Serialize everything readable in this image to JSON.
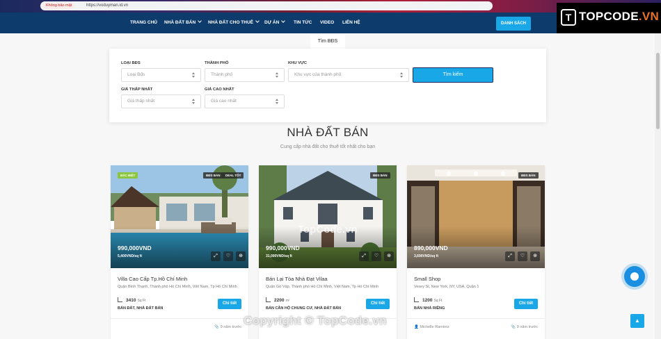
{
  "browser": {
    "security_label": "Không bảo mật",
    "url": "https://voduyman.id.vn"
  },
  "nav": {
    "items": [
      {
        "label": "TRANG CHỦ",
        "dropdown": false
      },
      {
        "label": "NHÀ ĐẤT BÁN",
        "dropdown": true
      },
      {
        "label": "NHÀ ĐẤT CHO THUÊ",
        "dropdown": true
      },
      {
        "label": "DỰ ÁN",
        "dropdown": true
      },
      {
        "label": "TIN TỨC",
        "dropdown": false
      },
      {
        "label": "VIDEO",
        "dropdown": false
      },
      {
        "label": "LIÊN HỆ",
        "dropdown": false
      }
    ],
    "cta_label": "DANH SÁCH"
  },
  "logo": {
    "mark": "T",
    "text_main": "TOPCODE",
    "text_tld": ".VN"
  },
  "search": {
    "tab_label": "Tìm BĐS",
    "fields": {
      "type": {
        "label": "LOẠI BĐS",
        "placeholder": "Loại Bđs"
      },
      "city": {
        "label": "THÀNH PHỐ",
        "placeholder": "Thành phố"
      },
      "area": {
        "label": "KHU VỰC",
        "placeholder": "Khu vực của thành phố"
      },
      "min_price": {
        "label": "GIÁ THẤP NHẤT",
        "placeholder": "Giá thấp nhất"
      },
      "max_price": {
        "label": "GIÁ CAO NHẤT",
        "placeholder": "Giá cao nhất"
      }
    },
    "button_label": "Tìm kiếm"
  },
  "section": {
    "title": "NHÀ ĐẤT BÁN",
    "subtitle": "Cung cấp nhà đất cho thuê tốt nhất cho bạn"
  },
  "cards": [
    {
      "badges": [
        "ĐẶC BIỆT",
        "BĐS BÁN",
        "DEAL TỐT"
      ],
      "price": "990,000VND",
      "price_per_unit": "5,400VND/sq ft",
      "title": "Villa Cao Cấp Tp.Hồ Chí Minh",
      "address": "Quận Bình Thạnh, Thành phố Hồ Chí Minh, Việt Nam, Tp Hồ Chí Minh",
      "area": "3410",
      "area_unit": "Sq Ft",
      "category": "BÁN ĐẤT, NHÀ ĐẤT BÁN",
      "detail_label": "Chi tiết",
      "footer_left": "",
      "footer_right": "9 năm trước"
    },
    {
      "badges": [
        "BĐS BÁN"
      ],
      "price": "990,000VND",
      "price_per_unit": "31,000VND/sq ft",
      "title": "Bán Lại Tòa Nhà Đạt Vilaa",
      "address": "Quận Gò Vấp, Thành phố Hồ Chí Minh, Việt Nam, Tp Hồ Chí Minh",
      "area": "2200",
      "area_unit": "m²",
      "category": "BÁN CĂN HỘ CHUNG CƯ, NHÀ ĐẤT BÁN",
      "detail_label": "Chi tiết",
      "footer_left": "",
      "footer_right": ""
    },
    {
      "badges": [
        "BĐS BÁN"
      ],
      "price": "890,000VND",
      "price_per_unit": "3,690VND/sq ft",
      "title": "Small Shop",
      "address": "Vesey St, New York, NY, USA, Quận 1",
      "area": "1200",
      "area_unit": "Sq Ft",
      "category": "BÁN NHÀ RIÊNG",
      "detail_label": "Chi tiết",
      "footer_left": "Michelle Ramirez",
      "footer_right": "9 năm trước"
    }
  ],
  "watermarks": {
    "image": "TopCode.vn",
    "bottom": "Copyright © TopCode.vn"
  },
  "icons": {
    "expand": "expand-icon",
    "heart": "heart-icon",
    "plus": "plus-circle-icon",
    "chat": "chat-icon",
    "back_to_top": "arrow-up-icon"
  },
  "colors": {
    "nav_bg": "#0d3b6c",
    "accent": "#1aa7e8",
    "badge_green": "#8cc63f"
  }
}
